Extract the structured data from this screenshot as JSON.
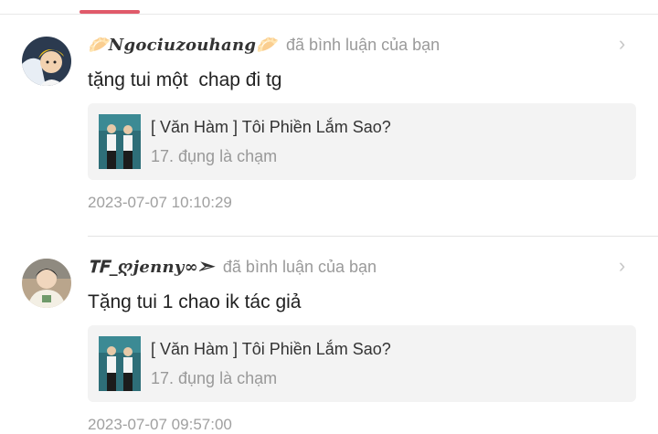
{
  "notifications": [
    {
      "username": "🥟𝑵𝒈𝒐𝒄𝒊𝒖𝒛𝒐𝒖𝒉𝒂𝒏𝒈🥟",
      "action": "đã bình luận của bạn",
      "comment": "tặng tui một  chap đi tg",
      "book_title": "[ Văn Hàm ] Tôi Phiền Lắm Sao?",
      "chapter": "17. đụng là chạm",
      "timestamp": "2023-07-07 10:10:29"
    },
    {
      "username": "𝐓𝐅_ღ𝒋𝒆𝒏𝒏𝒚∞➣",
      "action": "đã bình luận của bạn",
      "comment": "Tặng tui 1 chao ik tác giả",
      "book_title": "[ Văn Hàm ] Tôi Phiền Lắm Sao?",
      "chapter": "17. đụng là chạm",
      "timestamp": "2023-07-07 09:57:00"
    }
  ],
  "colors": {
    "accent": "#e05a6a",
    "card_bg": "#f3f3f3",
    "muted": "#9a9a9a"
  },
  "icons": {
    "chevron": "chevron-right-icon"
  }
}
